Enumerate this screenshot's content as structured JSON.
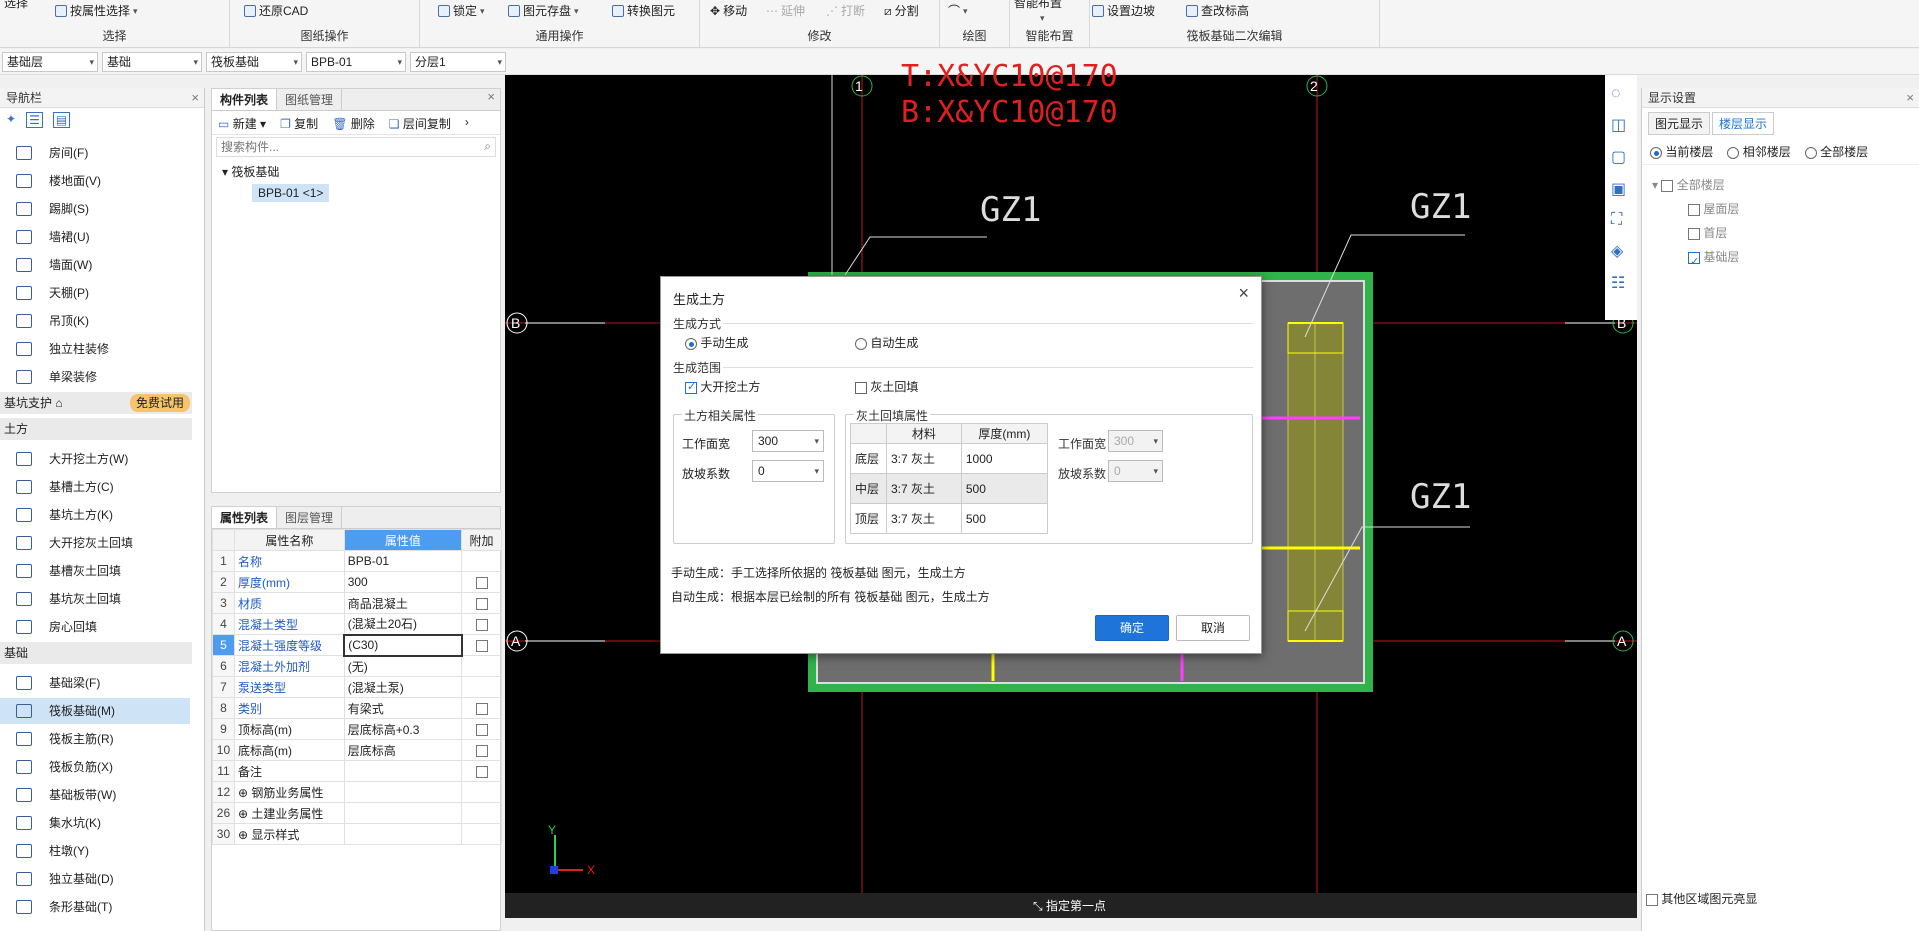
{
  "ribbon": {
    "groups": [
      {
        "label": "选择",
        "buttons": [
          "按属性选择"
        ],
        "top": "选择"
      },
      {
        "label": "图纸操作",
        "buttons": [
          "还原CAD"
        ]
      },
      {
        "label": "通用操作",
        "buttons": [
          "锁定",
          "图元存盘",
          "转换图元"
        ]
      },
      {
        "label": "修改",
        "buttons": [
          "移动",
          "延伸",
          "打断",
          "分割"
        ]
      },
      {
        "label": "绘图",
        "buttons": []
      },
      {
        "label": "智能布置",
        "buttons": [
          "智能布置"
        ]
      },
      {
        "label": "筏板基础二次编辑",
        "buttons": [
          "设置边坡",
          "查改标高"
        ]
      }
    ]
  },
  "selectors": [
    "基础层",
    "基础",
    "筏板基础",
    "BPB-01",
    "分层1"
  ],
  "nav": {
    "title": "导航栏",
    "items_top": [
      "房间(F)",
      "楼地面(V)",
      "踢脚(S)",
      "墙裙(U)",
      "墙面(W)",
      "天棚(P)",
      "吊顶(K)",
      "独立柱装修",
      "单梁装修"
    ],
    "section_pit": "基坑支护",
    "trial": "免费试用",
    "section_earth": "土方",
    "items_earth": [
      "大开挖土方(W)",
      "基槽土方(C)",
      "基坑土方(K)",
      "大开挖灰土回填",
      "基槽灰土回填",
      "基坑灰土回填",
      "房心回填"
    ],
    "section_found": "基础",
    "items_found": [
      "基础梁(F)",
      "筏板基础(M)",
      "筏板主筋(R)",
      "筏板负筋(X)",
      "基础板带(W)",
      "集水坑(K)",
      "柱墩(Y)",
      "独立基础(D)",
      "条形基础(T)"
    ]
  },
  "complist": {
    "tabs": [
      "构件列表",
      "图纸管理"
    ],
    "toolbar": [
      "新建",
      "复制",
      "删除",
      "层间复制"
    ],
    "search_placeholder": "搜索构件...",
    "tree_root": "筏板基础",
    "tree_child": "BPB-01 <1>"
  },
  "props": {
    "tabs": [
      "属性列表",
      "图层管理"
    ],
    "headers": [
      "属性名称",
      "属性值",
      "附加"
    ],
    "rows": [
      {
        "n": "1",
        "name": "名称",
        "value": "BPB-01",
        "blue": true,
        "cb": false
      },
      {
        "n": "2",
        "name": "厚度(mm)",
        "value": "300",
        "blue": true,
        "cb": true
      },
      {
        "n": "3",
        "name": "材质",
        "value": "商品混凝土",
        "blue": true,
        "cb": true
      },
      {
        "n": "4",
        "name": "混凝土类型",
        "value": "(混凝土20石)",
        "blue": true,
        "cb": true
      },
      {
        "n": "5",
        "name": "混凝土强度等级",
        "value": "(C30)",
        "blue": true,
        "cb": true
      },
      {
        "n": "6",
        "name": "混凝土外加剂",
        "value": "(无)",
        "blue": true,
        "cb": false
      },
      {
        "n": "7",
        "name": "泵送类型",
        "value": "(混凝土泵)",
        "blue": true,
        "cb": false
      },
      {
        "n": "8",
        "name": "类别",
        "value": "有梁式",
        "blue": true,
        "cb": true
      },
      {
        "n": "9",
        "name": "顶标高(m)",
        "value": "层底标高+0.3",
        "blue": false,
        "cb": true
      },
      {
        "n": "10",
        "name": "底标高(m)",
        "value": "层底标高",
        "blue": false,
        "cb": true
      },
      {
        "n": "11",
        "name": "备注",
        "value": "",
        "blue": false,
        "cb": true
      },
      {
        "n": "12",
        "name": "⊕ 钢筋业务属性",
        "value": "",
        "blue": false,
        "cb": false
      },
      {
        "n": "26",
        "name": "⊕ 土建业务属性",
        "value": "",
        "blue": false,
        "cb": false
      },
      {
        "n": "30",
        "name": "⊕ 显示样式",
        "value": "",
        "blue": false,
        "cb": false
      }
    ]
  },
  "canvas": {
    "axis_top": [
      "1",
      "2"
    ],
    "axis_side": [
      "B",
      "A"
    ],
    "rebar_text_1": "T:X&YC10@170",
    "rebar_text_2": "B:X&YC10@170",
    "gz_labels": [
      "GZ1",
      "GZ1",
      "GZ1"
    ],
    "status": "指定第一点",
    "axis_x": "X",
    "axis_y": "Y"
  },
  "right": {
    "title": "显示设置",
    "tabs": [
      "图元显示",
      "楼层显示"
    ],
    "radios": [
      "当前楼层",
      "相邻楼层",
      "全部楼层"
    ],
    "tree": [
      "全部楼层",
      "屋面层",
      "首层",
      "基础层"
    ],
    "bottom": "其他区域图元亮显"
  },
  "dialog": {
    "title": "生成土方",
    "mode_label": "生成方式",
    "manual": "手动生成",
    "auto": "自动生成",
    "range_label": "生成范围",
    "open_excavation": "大开挖土方",
    "lime_backfill": "灰土回填",
    "earth_props": "土方相关属性",
    "lime_props": "灰土回填属性",
    "work_width": "工作面宽",
    "work_width_val": "300",
    "slope": "放坡系数",
    "slope_val": "0",
    "lime_work_width": "工作面宽",
    "lime_work_width_val": "300",
    "lime_slope": "放坡系数",
    "lime_slope_val": "0",
    "table_headers": [
      "材料",
      "厚度(mm)"
    ],
    "table_rows": [
      {
        "layer": "底层",
        "mat": "3:7 灰土",
        "thick": "1000"
      },
      {
        "layer": "中层",
        "mat": "3:7 灰土",
        "thick": "500"
      },
      {
        "layer": "顶层",
        "mat": "3:7 灰土",
        "thick": "500"
      }
    ],
    "note_manual": "手动生成：手工选择所依据的 筏板基础 图元，生成土方",
    "note_auto": "自动生成：根据本层已绘制的所有 筏板基础 图元，生成土方",
    "ok": "确定",
    "cancel": "取消"
  },
  "colors": {
    "accent": "#1e74d8",
    "canvas": "#000000",
    "slab": "#2fb34a",
    "axis": "#c01818"
  }
}
